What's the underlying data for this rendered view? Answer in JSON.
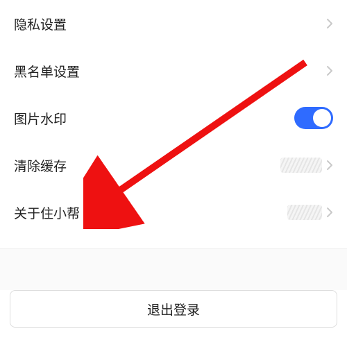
{
  "settings": {
    "rows": [
      {
        "label": "隐私设置"
      },
      {
        "label": "黑名单设置"
      },
      {
        "label": "图片水印",
        "toggle_on": true
      },
      {
        "label": "清除缓存",
        "value_obscured": true
      },
      {
        "label": "关于住小帮",
        "value_obscured": true
      }
    ]
  },
  "logout_label": "退出登录",
  "annotation": {
    "arrow_color": "#e11"
  }
}
